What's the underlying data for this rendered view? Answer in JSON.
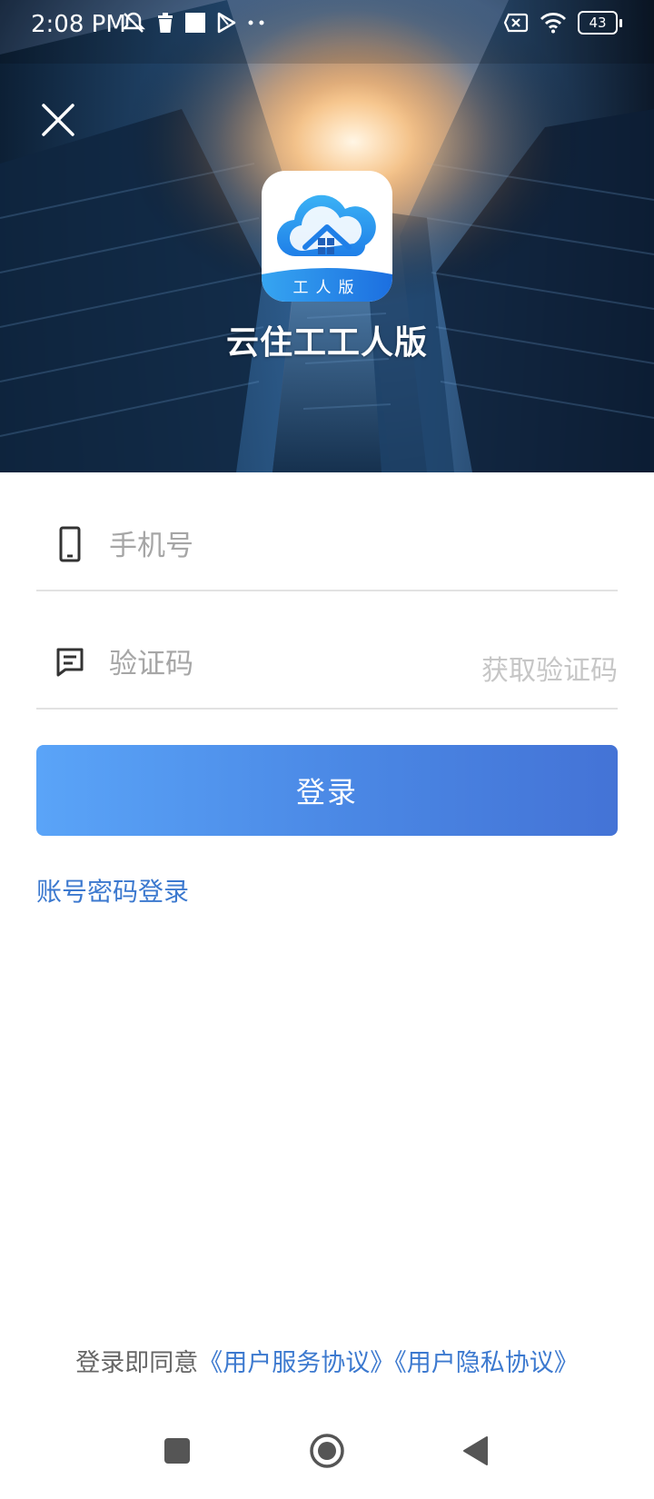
{
  "status_bar": {
    "time": "2:08 PM",
    "battery": "43",
    "left_icons": [
      "mute-icon",
      "trash-icon",
      "square-icon",
      "play-store-icon",
      "more-dots-icon"
    ],
    "right_icons": [
      "sim-off-icon",
      "wifi-icon",
      "battery-icon"
    ]
  },
  "header": {
    "close_icon": "close-icon",
    "logo_banner": "工人版",
    "app_name": "云住工工人版"
  },
  "form": {
    "phone": {
      "placeholder": "手机号",
      "value": "",
      "icon": "phone-icon"
    },
    "code": {
      "placeholder": "验证码",
      "value": "",
      "icon": "message-icon",
      "get_code_label": "获取验证码"
    },
    "login_label": "登录",
    "password_login_label": "账号密码登录"
  },
  "agreement": {
    "prefix": "登录即同意",
    "user_service": "《用户服务协议》",
    "user_privacy": "《用户隐私协议》"
  },
  "nav_bar": {
    "icons": [
      "recent-apps-icon",
      "home-icon",
      "back-icon"
    ]
  },
  "colors": {
    "accent": "#3c79cf",
    "button_start": "#5aa4f8",
    "button_end": "#4473d6",
    "placeholder": "#a6a6a6",
    "divider": "#e2e2e2"
  }
}
